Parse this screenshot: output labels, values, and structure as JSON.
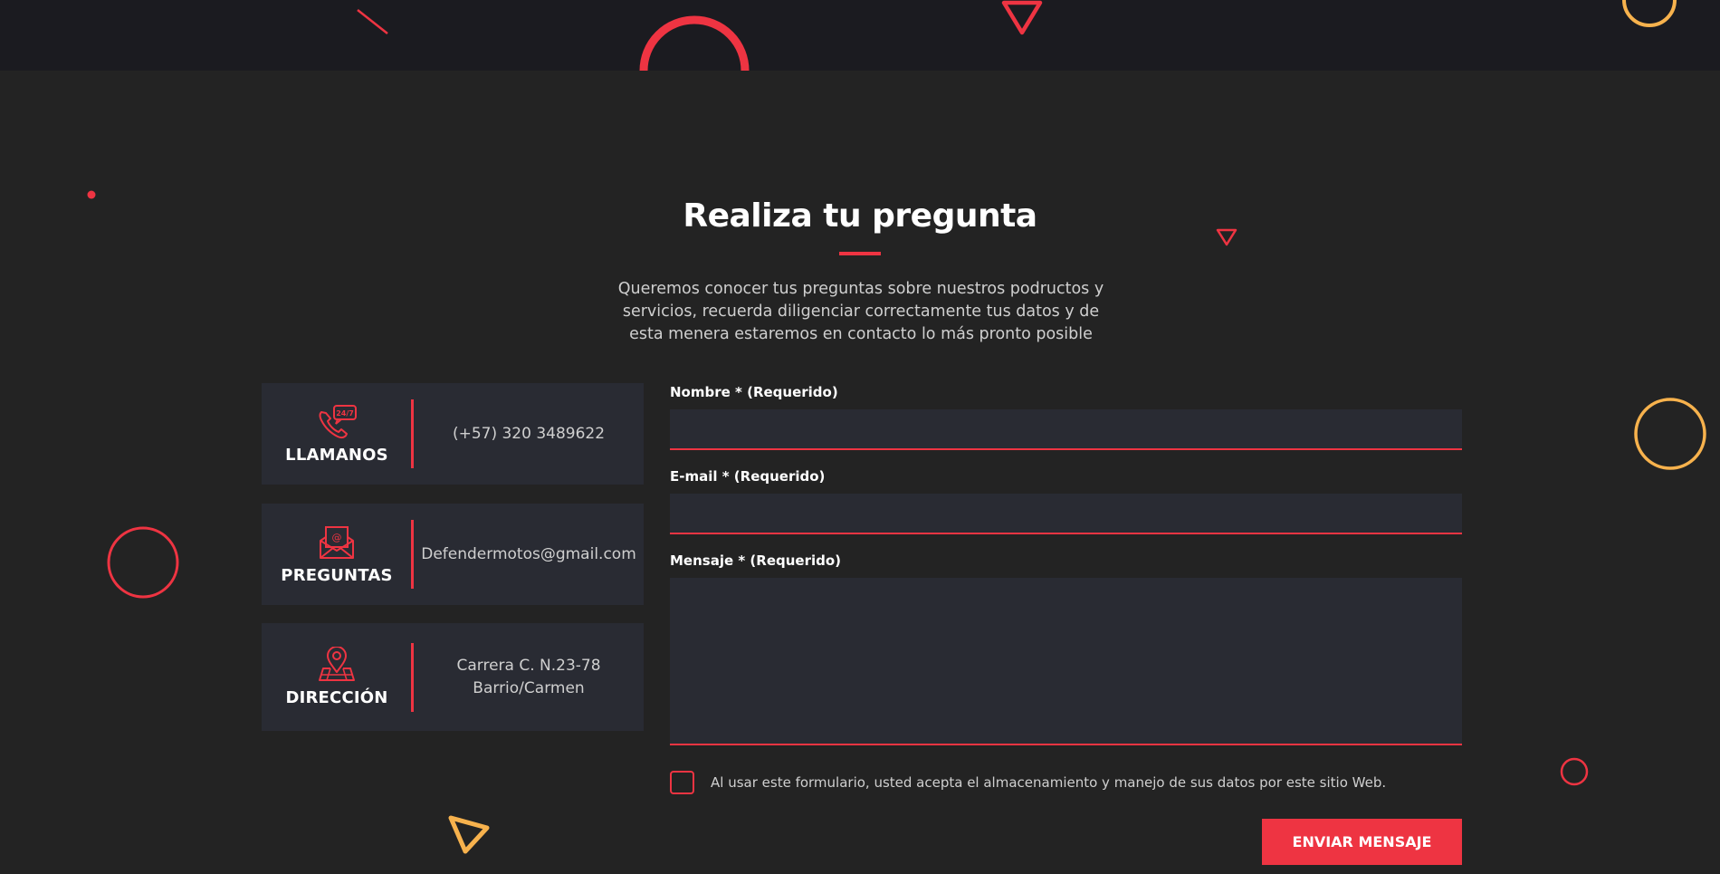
{
  "section": {
    "title": "Realiza tu pregunta",
    "intro": "Queremos conocer tus preguntas sobre nuestros podructos y servicios, recuerda diligenciar correctamente tus datos y de esta menera estaremos en contacto lo más pronto posible"
  },
  "contact_cards": [
    {
      "label": "LLAMANOS",
      "value": "(+57) 320 3489622",
      "icon": "phone-24-7-icon"
    },
    {
      "label": "PREGUNTAS",
      "value": "Defendermotos@gmail.com",
      "icon": "envelope-icon"
    },
    {
      "label": "DIRECCIÓN",
      "value": "Carrera C. N.23-78 Barrio/Carmen",
      "icon": "location-pin-icon"
    }
  ],
  "form": {
    "name_label": "Nombre * (Requerido)",
    "name_value": "",
    "email_label": "E-mail * (Requerido)",
    "email_value": "",
    "message_label": "Mensaje * (Requerido)",
    "message_value": "",
    "consent_text": "Al usar este formulario, usted acepta el almacenamiento y manejo de sus datos por este sitio Web.",
    "consent_checked": false,
    "submit_label": "ENVIAR MENSAJE"
  },
  "colors": {
    "background": "#232323",
    "top_band": "#1b1b20",
    "card": "#292b33",
    "accent": "#ee3442",
    "decor_yellow": "#f7b24d"
  }
}
